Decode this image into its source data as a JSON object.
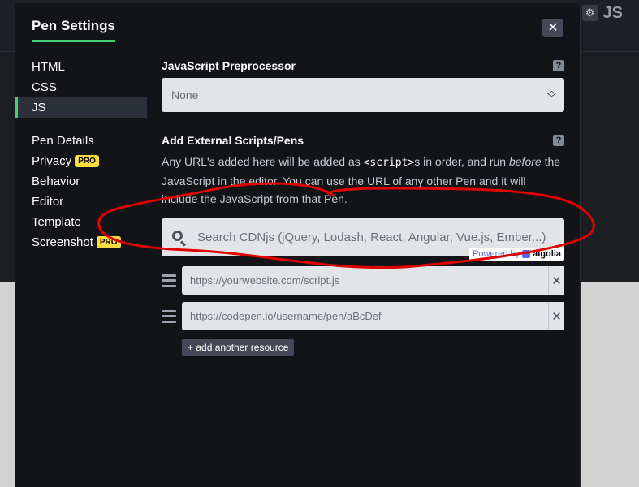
{
  "background": {
    "js_label": "JS",
    "gear_icon": "gear-icon"
  },
  "modal": {
    "title": "Pen Settings",
    "close_label": "✕"
  },
  "nav": {
    "items": [
      {
        "label": "HTML"
      },
      {
        "label": "CSS"
      },
      {
        "label": "JS",
        "active": true
      },
      {
        "label": "Pen Details"
      },
      {
        "label": "Privacy",
        "badge": "PRO"
      },
      {
        "label": "Behavior"
      },
      {
        "label": "Editor"
      },
      {
        "label": "Template"
      },
      {
        "label": "Screenshot",
        "badge": "PRO"
      }
    ]
  },
  "preprocessor": {
    "title": "JavaScript Preprocessor",
    "help": "?",
    "selected": "None"
  },
  "external": {
    "title": "Add External Scripts/Pens",
    "help": "?",
    "desc_1": "Any URL's added here will be added as ",
    "desc_code": "<script>",
    "desc_2": "s in order, and run ",
    "desc_em": "before",
    "desc_3": " the JavaScript in the editor. You can use the URL of any other Pen and it will include the JavaScript from that Pen.",
    "search_placeholder": "Search CDNjs (jQuery, Lodash, React, Angular, Vue.js, Ember...)",
    "powered_by": "Powered by",
    "algolia": "algolia",
    "resources": [
      {
        "placeholder": "https://yourwebsite.com/script.js"
      },
      {
        "placeholder": "https://codepen.io/username/pen/aBcDef"
      }
    ],
    "add_resource": "+ add another resource"
  },
  "colors": {
    "accent": "#47cf73",
    "pro_badge": "#ffdd40",
    "annotation": "#e00000"
  }
}
